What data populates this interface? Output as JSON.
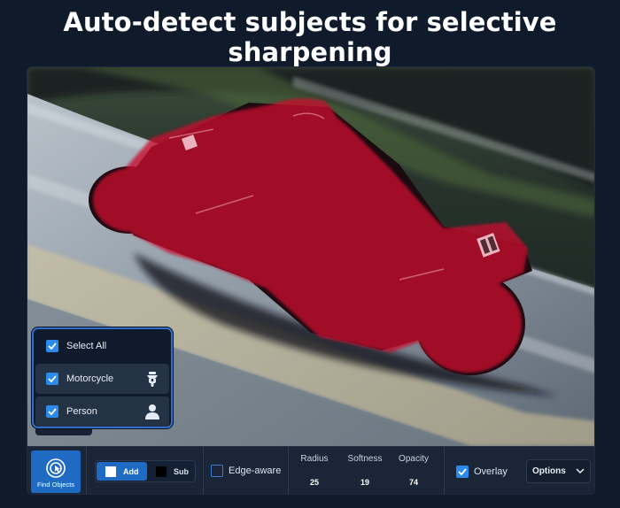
{
  "headline": "Auto-detect subjects for selective sharpening",
  "objects": {
    "items": [
      {
        "label": "Select All",
        "checked": true,
        "icon": "none"
      },
      {
        "label": "Motorcycle",
        "checked": true,
        "icon": "motorcycle-icon"
      },
      {
        "label": "Person",
        "checked": true,
        "icon": "person-icon"
      }
    ]
  },
  "toolbar": {
    "find_objects_label": "Find Objects",
    "add_label": "Add",
    "sub_label": "Sub",
    "edge_aware_label": "Edge-aware",
    "edge_aware_checked": false,
    "radius_label": "Radius",
    "radius_value": "25",
    "softness_label": "Softness",
    "softness_value": "19",
    "opacity_label": "Opacity",
    "opacity_value": "74",
    "overlay_label": "Overlay",
    "overlay_checked": true,
    "options_label": "Options"
  },
  "colors": {
    "accent": "#1f6bc4",
    "checkbox": "#2d8ae8",
    "mask_overlay": "#c8102e",
    "background": "#0f1a2b"
  }
}
